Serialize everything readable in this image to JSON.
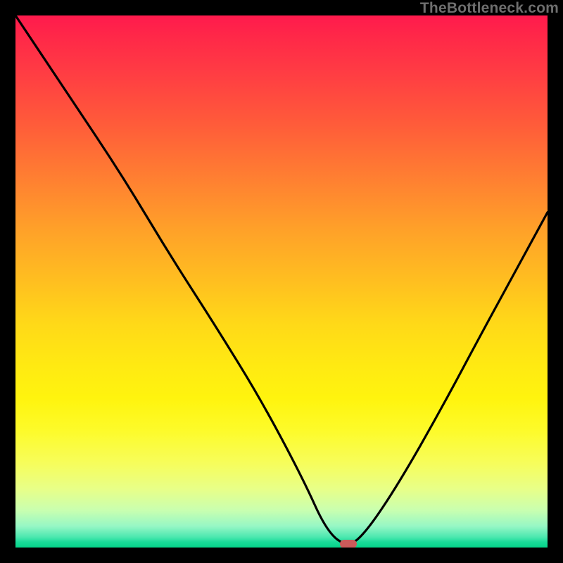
{
  "watermark": "TheBottleneck.com",
  "marker": {
    "x_pct": 62.5,
    "y_pct": 99.3
  },
  "chart_data": {
    "type": "line",
    "title": "",
    "xlabel": "",
    "ylabel": "",
    "xlim": [
      0,
      100
    ],
    "ylim": [
      0,
      100
    ],
    "series": [
      {
        "name": "bottleneck-curve",
        "x": [
          0,
          10,
          20,
          29,
          38,
          46,
          54,
          58.5,
          62.5,
          66,
          72,
          80,
          88,
          94,
          100
        ],
        "y": [
          100,
          85,
          70,
          55,
          41,
          28,
          13,
          3,
          0,
          3,
          12,
          26,
          41,
          52,
          63
        ]
      }
    ],
    "annotations": [
      {
        "name": "optimal-point",
        "x": 62.5,
        "y": 0
      }
    ],
    "background_gradient": {
      "stops": [
        {
          "pct": 0,
          "color": "#ff1a4d"
        },
        {
          "pct": 50,
          "color": "#ffd918"
        },
        {
          "pct": 100,
          "color": "#05d489"
        }
      ]
    }
  }
}
